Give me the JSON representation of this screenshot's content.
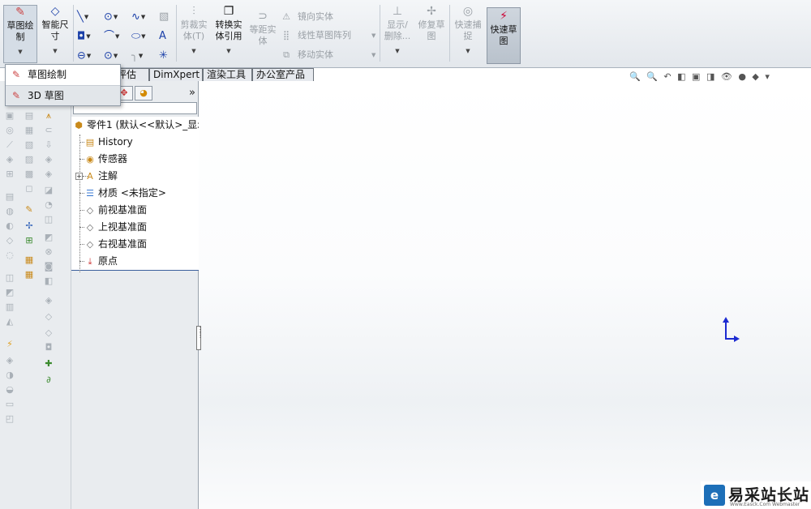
{
  "ribbon": {
    "sketch_draw": {
      "line1": "草图绘",
      "line2": "制"
    },
    "smart_dim": {
      "line1": "智能尺",
      "line2": "寸"
    },
    "trim": {
      "line1": "剪裁实",
      "line2": "体(T)"
    },
    "convert": {
      "line1": "转换实",
      "line2": "体引用"
    },
    "offset": {
      "line1": "等距实",
      "line2": "体"
    },
    "mirror_label": "镜向实体",
    "linear_pattern_label": "线性草图阵列",
    "move_label": "移动实体",
    "show_delete": {
      "line1": "显示/",
      "line2": "删除..."
    },
    "repair": {
      "line1": "修复草",
      "line2": "图"
    },
    "quick_snap": {
      "line1": "快速捕",
      "line2": "捉"
    },
    "rapid_sketch": {
      "line1": "快速草",
      "line2": "图"
    }
  },
  "menu": {
    "items": [
      {
        "label": "草图绘制"
      },
      {
        "label": "3D 草图"
      }
    ]
  },
  "tabs": [
    {
      "label": "评估"
    },
    {
      "label": "DimXpert"
    },
    {
      "label": "渲染工具"
    },
    {
      "label": "办公室产品"
    }
  ],
  "tree": {
    "root": "零件1 (默认<<默认>_显示",
    "nodes": [
      {
        "label": "History"
      },
      {
        "label": "传感器"
      },
      {
        "label": "注解"
      },
      {
        "label": "材质 <未指定>"
      },
      {
        "label": "前视基准面"
      },
      {
        "label": "上视基准面"
      },
      {
        "label": "右视基准面"
      },
      {
        "label": "原点"
      }
    ],
    "more_chevron": "»"
  },
  "watermark": {
    "text": "易采站长站",
    "sub": "Www.Easck.Com Webmaster"
  }
}
